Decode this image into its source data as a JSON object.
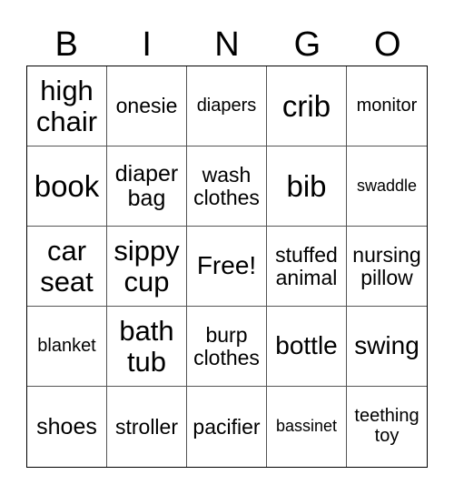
{
  "header": [
    "B",
    "I",
    "N",
    "G",
    "O"
  ],
  "rows": [
    [
      "high chair",
      "onesie",
      "diapers",
      "crib",
      "monitor"
    ],
    [
      "book",
      "diaper bag",
      "wash clothes",
      "bib",
      "swaddle"
    ],
    [
      "car seat",
      "sippy cup",
      "Free!",
      "stuffed animal",
      "nursing pillow"
    ],
    [
      "blanket",
      "bath tub",
      "burp clothes",
      "bottle",
      "swing"
    ],
    [
      "shoes",
      "stroller",
      "pacifier",
      "bassinet",
      "teething toy"
    ]
  ]
}
